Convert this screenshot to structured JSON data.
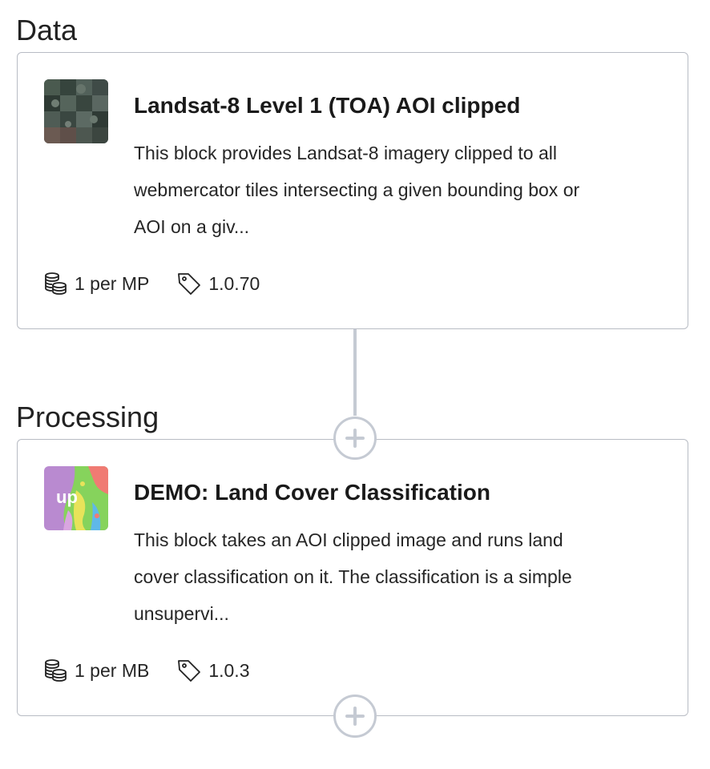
{
  "sections": {
    "data_title": "Data",
    "processing_title": "Processing"
  },
  "blocks": [
    {
      "title": "Landsat-8 Level 1 (TOA) AOI clipped",
      "description": "This block provides Landsat-8 imagery clipped to all webmercator tiles intersecting a given bounding box or AOI on a giv...",
      "price": "1 per MP",
      "version": "1.0.70",
      "thumbnail_icon": "satellite-image-thumbnail"
    },
    {
      "title": "DEMO: Land Cover Classification",
      "description": "This block takes an AOI clipped image and runs land cover classification on it. The classification is a simple unsupervi...",
      "price": "1 per MB",
      "version": "1.0.3",
      "thumbnail_icon": "land-cover-thumbnail",
      "thumbnail_logo": "up"
    }
  ],
  "icons": {
    "price": "coins-icon",
    "version": "tag-icon",
    "add": "plus-icon"
  },
  "colors": {
    "border": "#b8bcc4",
    "connector": "#c5cad3",
    "text": "#262626"
  }
}
